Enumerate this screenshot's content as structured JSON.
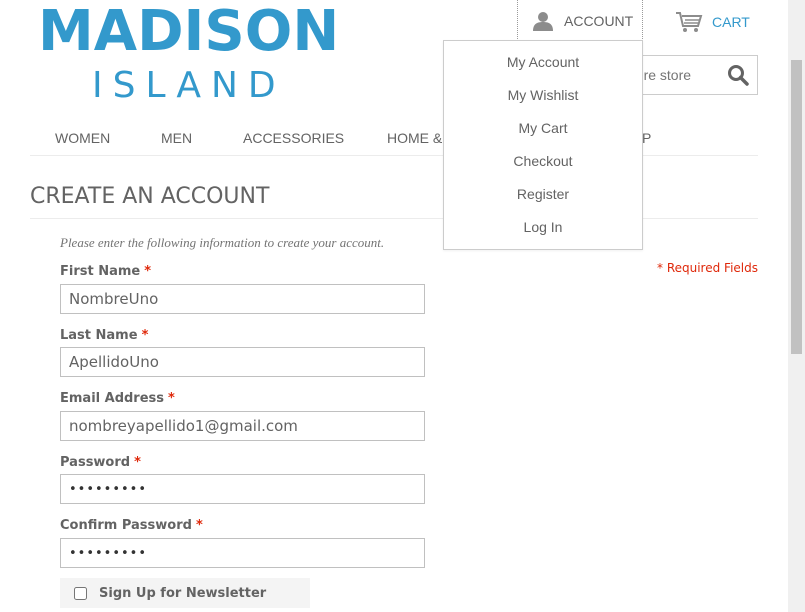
{
  "logo": {
    "main": "MADISON",
    "sub": "ISLAND"
  },
  "header": {
    "account_label": "ACCOUNT",
    "cart_label": "CART",
    "search_placeholder": "entire store"
  },
  "nav": {
    "items": [
      "WOMEN",
      "MEN",
      "ACCESSORIES",
      "HOME &",
      "P"
    ]
  },
  "account_menu": {
    "items": [
      "My Account",
      "My Wishlist",
      "My Cart",
      "Checkout",
      "Register",
      "Log In"
    ]
  },
  "page": {
    "title": "CREATE AN ACCOUNT",
    "intro": "Please enter the following information to create your account.",
    "required_note": "* Required Fields"
  },
  "form": {
    "first_name": {
      "label": "First Name",
      "value": "NombreUno"
    },
    "last_name": {
      "label": "Last Name",
      "value": "ApellidoUno"
    },
    "email": {
      "label": "Email Address",
      "value": "nombreyapellido1@gmail.com"
    },
    "password": {
      "label": "Password",
      "value": "•••••••••"
    },
    "confirm_password": {
      "label": "Confirm Password",
      "value": "•••••••••"
    },
    "required_star": "*",
    "newsletter_label": "Sign Up for Newsletter"
  },
  "colors": {
    "brand": "#3399cc",
    "text": "#636363",
    "required": "#df280a"
  }
}
